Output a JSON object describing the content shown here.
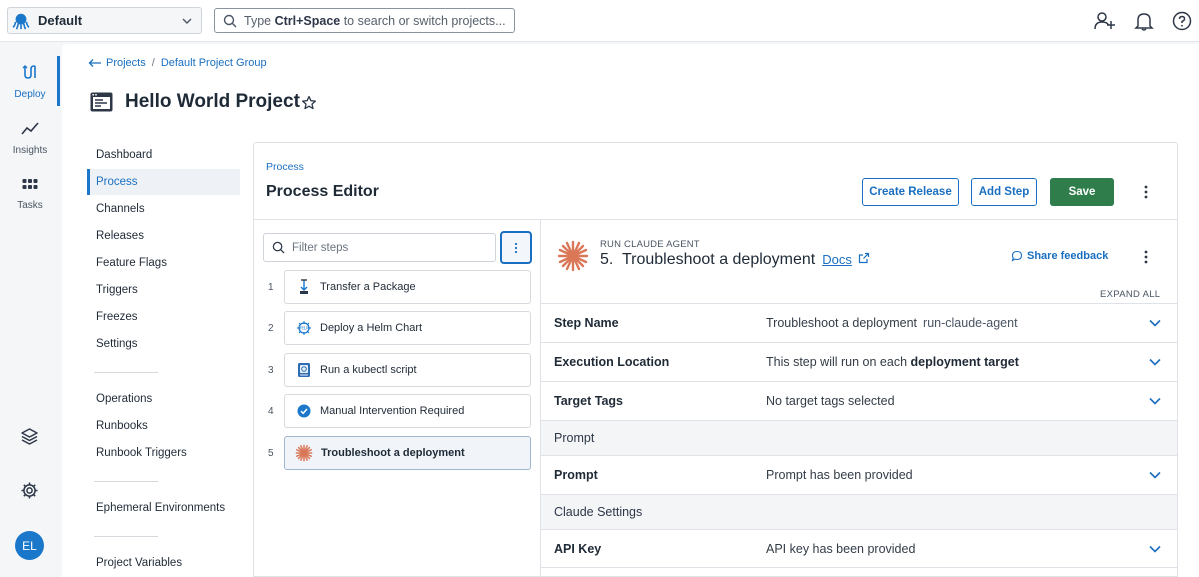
{
  "topbar": {
    "space_name": "Default",
    "search_placeholder_prefix": "Type ",
    "search_placeholder_key": "Ctrl+Space",
    "search_placeholder_suffix": " to search or switch projects..."
  },
  "rail": {
    "items": [
      {
        "label": "Deploy",
        "icon": "deploy-icon"
      },
      {
        "label": "Insights",
        "icon": "insights-icon"
      },
      {
        "label": "Tasks",
        "icon": "tasks-icon"
      }
    ],
    "avatar_initials": "EL"
  },
  "breadcrumb": {
    "projects": "Projects",
    "separator": "/",
    "group": "Default Project Group"
  },
  "project": {
    "title": "Hello World Project"
  },
  "project_nav": {
    "items": [
      "Dashboard",
      "Process",
      "Channels",
      "Releases",
      "Feature Flags",
      "Triggers",
      "Freezes",
      "Settings"
    ],
    "operations": [
      "Operations",
      "Runbooks",
      "Runbook Triggers"
    ],
    "env": [
      "Ephemeral Environments"
    ],
    "vars": [
      "Project Variables"
    ],
    "active": "Process"
  },
  "editor": {
    "crumb": "Process",
    "title": "Process Editor",
    "create_release": "Create Release",
    "add_step": "Add Step",
    "save": "Save"
  },
  "steps": {
    "filter_placeholder": "Filter steps",
    "list": [
      {
        "num": "1",
        "label": "Transfer a Package",
        "icon": "package-icon"
      },
      {
        "num": "2",
        "label": "Deploy a Helm Chart",
        "icon": "helm-icon"
      },
      {
        "num": "3",
        "label": "Run a kubectl script",
        "icon": "kubectl-icon"
      },
      {
        "num": "4",
        "label": "Manual Intervention Required",
        "icon": "check-circle-icon"
      },
      {
        "num": "5",
        "label": "Troubleshoot a deployment",
        "icon": "claude-icon"
      }
    ]
  },
  "detail": {
    "kind": "RUN CLAUDE AGENT",
    "heading": "5.  Troubleshoot a deployment",
    "docs": "Docs",
    "share_feedback": "Share feedback",
    "expand_all": "EXPAND ALL",
    "rows": {
      "step_name_label": "Step Name",
      "step_name_value": "Troubleshoot a deployment",
      "step_name_slug": "run-claude-agent",
      "exec_label": "Execution Location",
      "exec_value_prefix": "This step will run on each ",
      "exec_value_bold": "deployment target",
      "tags_label": "Target Tags",
      "tags_value": "No target tags selected",
      "prompt_section": "Prompt",
      "prompt_label": "Prompt",
      "prompt_value": "Prompt has been provided",
      "claude_section": "Claude Settings",
      "api_label": "API Key",
      "api_value": "API key has been provided"
    }
  },
  "colors": {
    "accent": "#1a77ca",
    "save": "#2e7d4a",
    "claude": "#d97757"
  }
}
